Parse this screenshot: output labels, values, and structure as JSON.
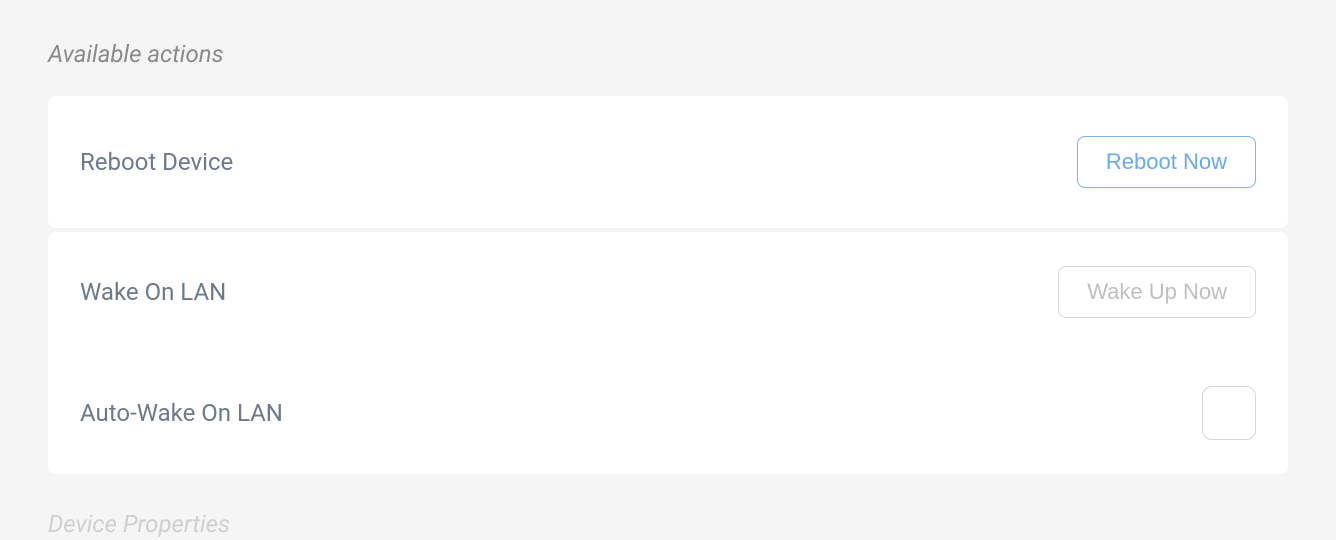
{
  "section": {
    "title": "Available actions"
  },
  "actions": {
    "reboot": {
      "label": "Reboot Device",
      "button": "Reboot Now"
    },
    "wol": {
      "label": "Wake On LAN",
      "button": "Wake Up Now"
    },
    "autowol": {
      "label": "Auto-Wake On LAN",
      "checked": false
    }
  },
  "next_section": {
    "title": "Device Properties"
  }
}
